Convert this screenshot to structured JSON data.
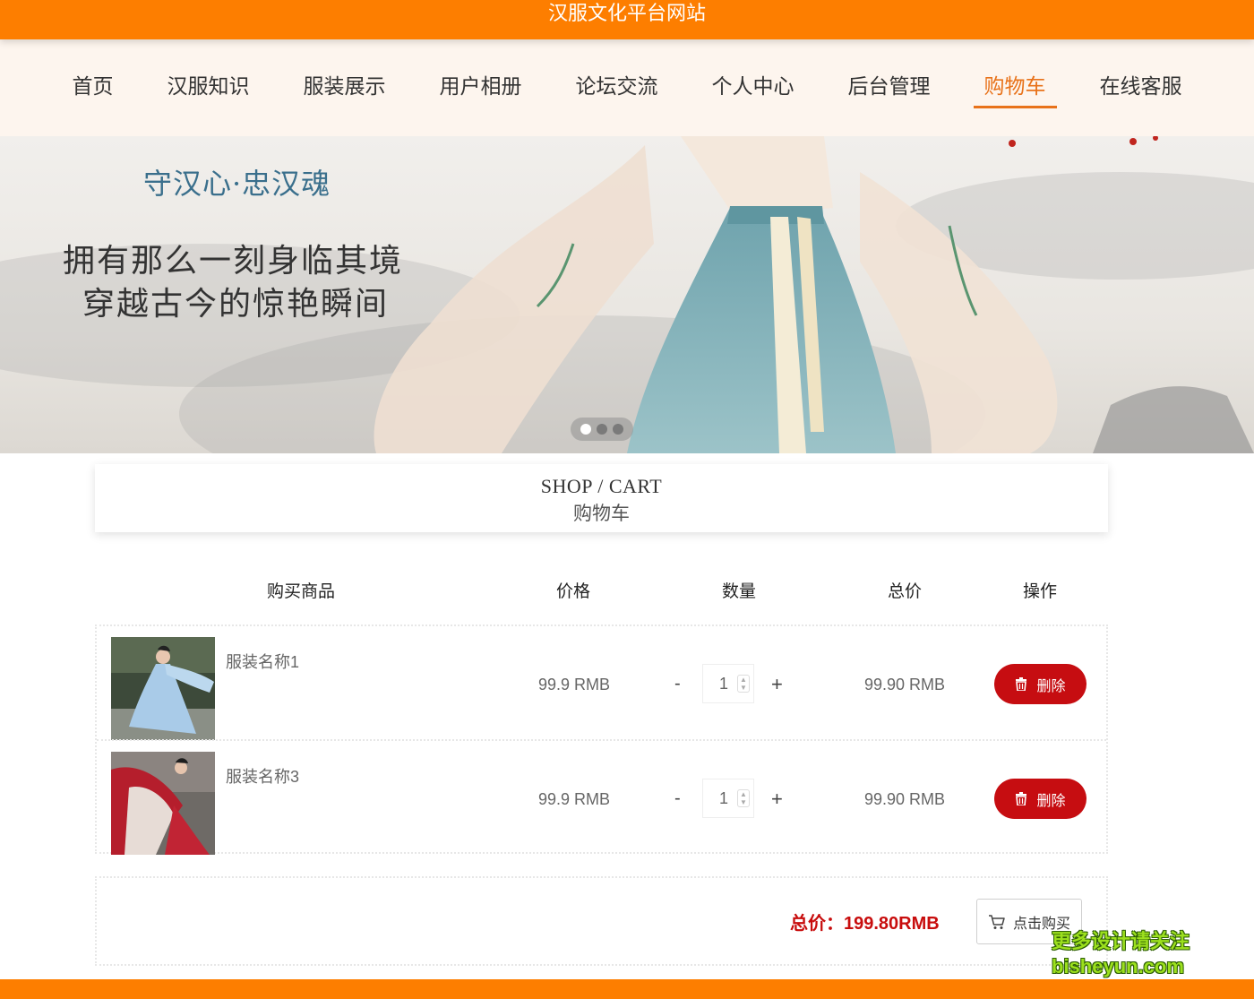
{
  "site": {
    "title": "汉服文化平台网站"
  },
  "nav": {
    "items": [
      "首页",
      "汉服知识",
      "服装展示",
      "用户相册",
      "论坛交流",
      "个人中心",
      "后台管理",
      "购物车",
      "在线客服"
    ],
    "active_index": 7
  },
  "banner": {
    "slogan": "守汉心·忠汉魂",
    "line1": "拥有那么一刻身临其境",
    "line2": "穿越古今的惊艳瞬间",
    "slide_count": 3,
    "active_slide": 1
  },
  "cart": {
    "title_en": "SHOP / CART",
    "title_cn": "购物车",
    "columns": [
      "购买商品",
      "价格",
      "数量",
      "总价",
      "操作"
    ],
    "items": [
      {
        "name": "服装名称1",
        "price": "99.9 RMB",
        "quantity": "1",
        "total": "99.90 RMB",
        "delete_label": "删除",
        "minus": "-",
        "plus": "+"
      },
      {
        "name": "服装名称3",
        "price": "99.9 RMB",
        "quantity": "1",
        "total": "99.90 RMB",
        "delete_label": "删除",
        "minus": "-",
        "plus": "+"
      }
    ],
    "sum_label": "总价：199.80RMB",
    "buy_label": "点击购买"
  },
  "watermark": {
    "line1": "更多设计请关注",
    "line2": "bisheyun.com"
  },
  "colors": {
    "accent": "#fd7e00",
    "active_nav": "#e8721a",
    "delete_red": "#c60d11",
    "sum_red": "#c80d0d"
  }
}
